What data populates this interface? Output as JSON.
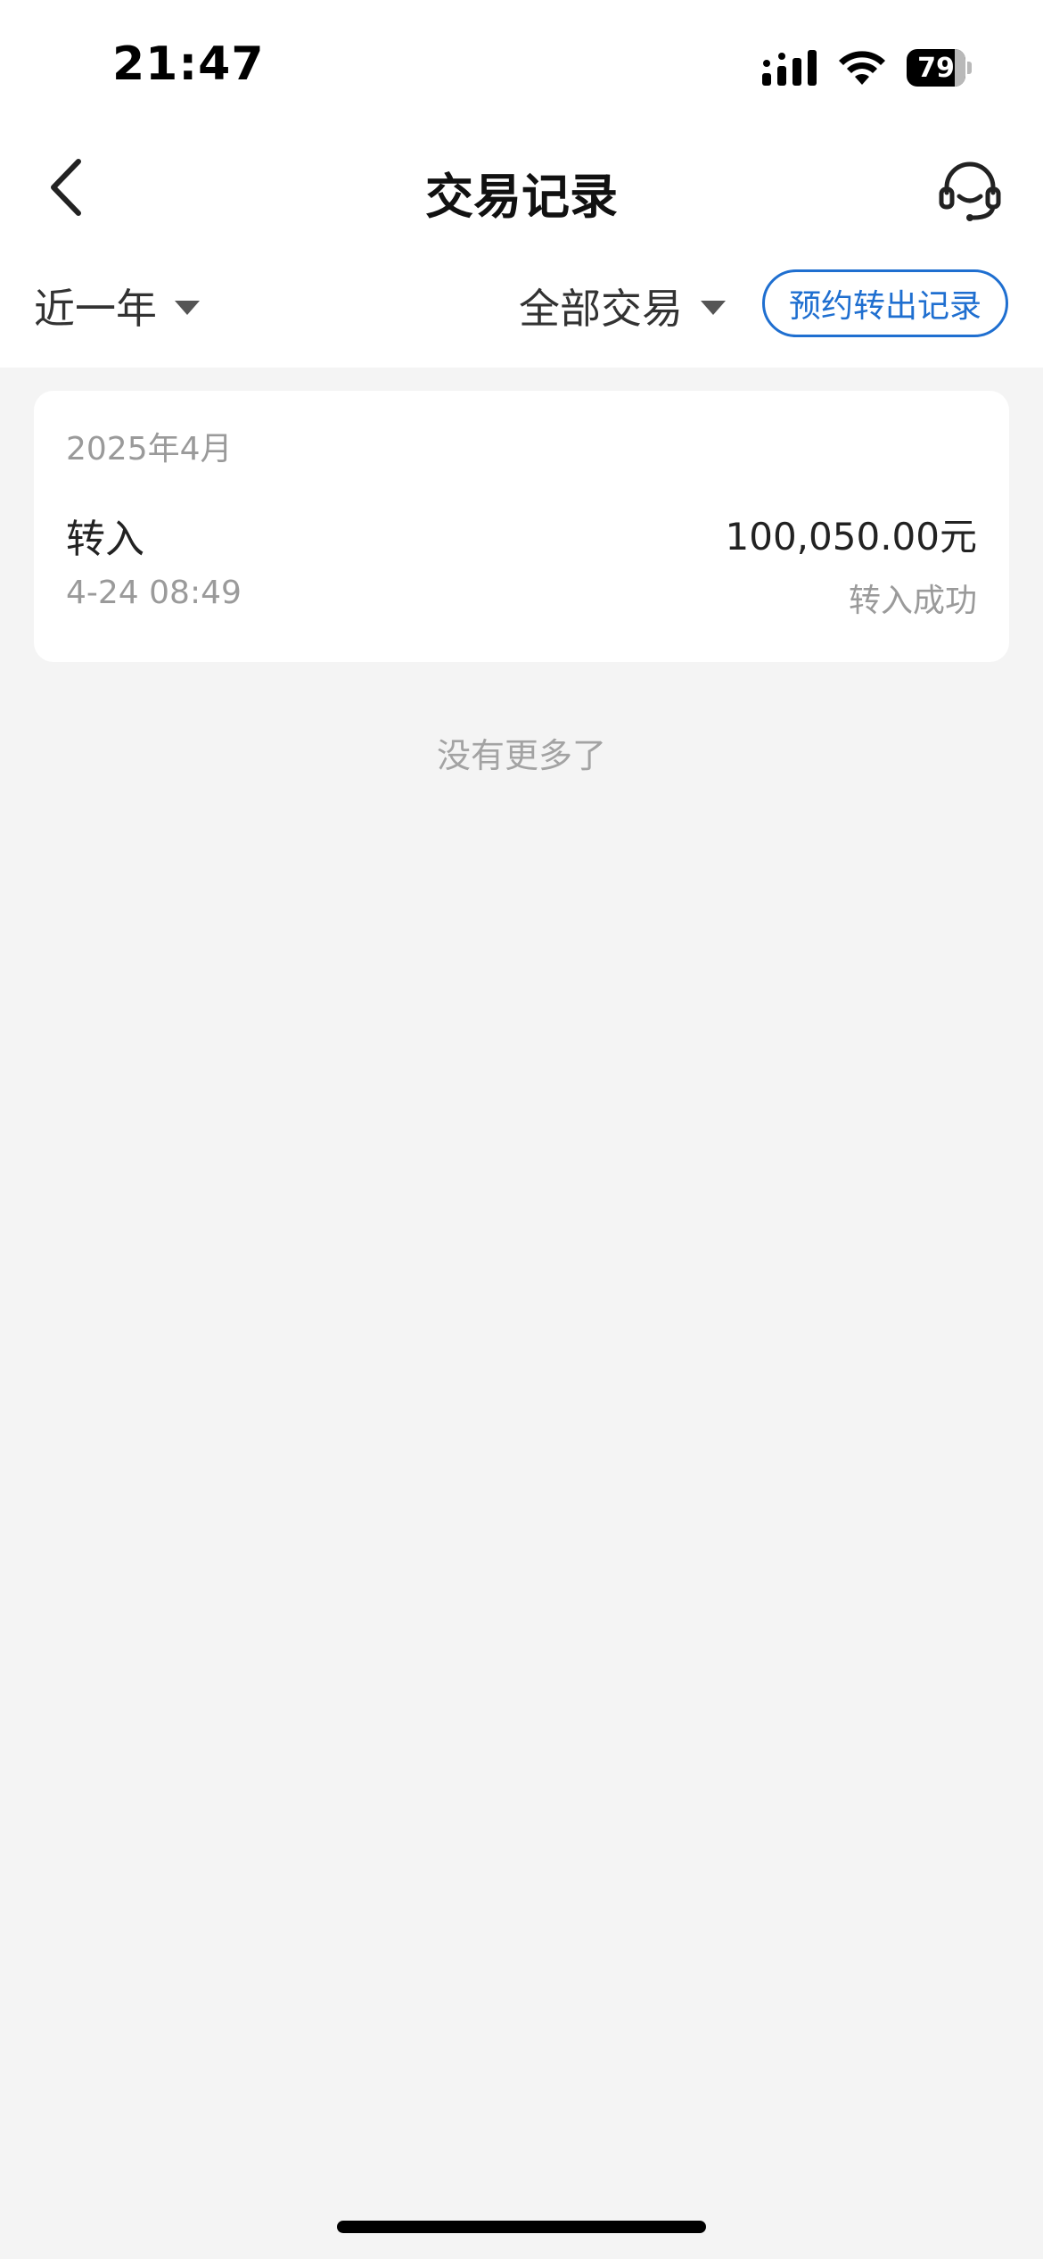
{
  "status_bar": {
    "time": "21:47",
    "battery": "79",
    "icons": [
      "signal-icon",
      "wifi-icon",
      "battery-icon"
    ]
  },
  "nav": {
    "title": "交易记录",
    "back_icon": "back-chevron-icon",
    "service_icon": "customer-service-headset-icon"
  },
  "filters": {
    "period_label": "近一年",
    "type_label": "全部交易",
    "scheduled_button_label": "预约转出记录",
    "accent_color": "#1f6fd0"
  },
  "records": {
    "month": "2025年4月",
    "items": [
      {
        "type": "转入",
        "amount": "100,050.00元",
        "time": "4-24 08:49",
        "status": "转入成功"
      }
    ]
  },
  "footer": {
    "no_more_text": "没有更多了"
  }
}
